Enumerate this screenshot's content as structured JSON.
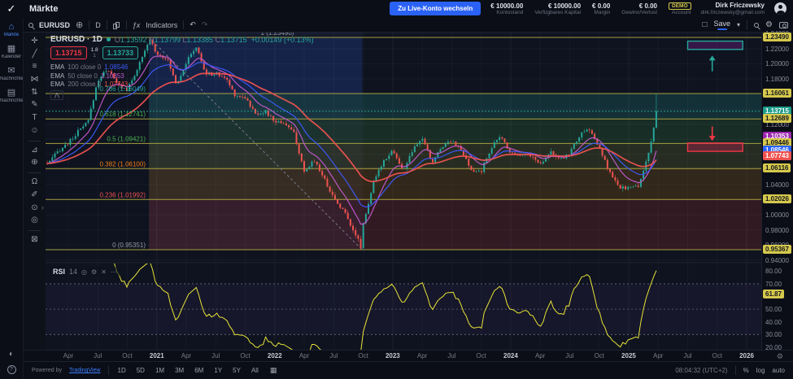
{
  "header": {
    "app_title": "Märkte",
    "live_button_label": "Zu Live-Konto wechseln",
    "stats": [
      {
        "value": "€ 10000.00",
        "label": "Kontostand"
      },
      {
        "value": "€ 10000.00",
        "label": "Verfügbares Kapital"
      },
      {
        "value": "€ 0.00",
        "label": "Margin"
      },
      {
        "value": "€ 0.00",
        "label": "Gewinn/Verlust"
      },
      {
        "value": "DEMO",
        "label": "Account",
        "badge": true
      }
    ],
    "user": {
      "name": "Dirk Friczewsky",
      "email": "dirk.friczewsky@gmail.com"
    }
  },
  "sidebar": {
    "items": [
      {
        "label": "Märkte",
        "icon": "home-icon",
        "glyph": "⌂",
        "active": true
      },
      {
        "label": "Kalender",
        "icon": "calendar-icon",
        "glyph": "▦",
        "active": false
      },
      {
        "label": "Nachrichten",
        "icon": "mail-icon",
        "glyph": "✉",
        "active": false
      },
      {
        "label": "Nachrichten",
        "icon": "news-icon",
        "glyph": "▤",
        "active": false
      }
    ],
    "bottom": [
      {
        "label": "theme-toggle",
        "glyph": "◐"
      },
      {
        "label": "help",
        "glyph": "?"
      }
    ]
  },
  "chart_toolbar": {
    "symbol": "EURUSD",
    "interval": "D",
    "indicators_fx": "ƒx",
    "indicators_label": "Indicators",
    "undo": "↶",
    "redo": "↷",
    "compare": "⊕",
    "layout_square": "□",
    "save_label": "Save",
    "caret": "▾"
  },
  "legend": {
    "symbol_text": "EURUSD · 1D",
    "ohlc": [
      {
        "k": "O",
        "v": "1.13592"
      },
      {
        "k": "H",
        "v": "1.13799"
      },
      {
        "k": "L",
        "v": "1.13385"
      },
      {
        "k": "C",
        "v": "1.13715"
      }
    ],
    "change": "+0.00149 (+0.13%)",
    "bid": "1.13715",
    "ask": "1.13733",
    "spread_top": "1.8",
    "spread_bottom": "1",
    "emas": [
      {
        "label": "EMA 100 close 0",
        "value": "1.08546",
        "color": "#3d5afe"
      },
      {
        "label": "EMA 50 close 0",
        "value": "1.10353",
        "color": "#c45ad0"
      },
      {
        "label": "EMA 200 close 0",
        "value": "1.07743",
        "color": "#ef5350"
      }
    ]
  },
  "price_axis": {
    "ticks": [
      [
        "1.24000",
        1.24
      ],
      [
        "1.22000",
        1.22
      ],
      [
        "1.20000",
        1.2
      ],
      [
        "1.18000",
        1.18
      ],
      [
        "1.16000",
        1.16
      ],
      [
        "1.12000",
        1.12
      ],
      [
        "1.04000",
        1.04
      ],
      [
        "1.00000",
        1.0
      ],
      [
        "0.98000",
        0.98
      ],
      [
        "0.96000",
        0.96
      ],
      [
        "0.94000",
        0.94
      ]
    ],
    "labels": [
      {
        "text": "1.23490",
        "price": 1.2349,
        "bg": "#d5c84c",
        "fg": "#14161f",
        "name": "fib-level-label"
      },
      {
        "text": "1.16061",
        "price": 1.16061,
        "bg": "#d5c84c",
        "fg": "#14161f",
        "name": "level-line-label"
      },
      {
        "text": "1.13715",
        "price": 1.13715,
        "bg": "#1f9d8b",
        "fg": "#ffffff",
        "name": "last-price-label"
      },
      {
        "text": "1.12689",
        "price": 1.12689,
        "bg": "#d5c84c",
        "fg": "#14161f",
        "name": "level-line-label"
      },
      {
        "text": "1.10353",
        "price": 1.10353,
        "bg": "#9c27b0",
        "fg": "#ffffff",
        "name": "ema50-price-label"
      },
      {
        "text": "1.09446",
        "price": 1.09446,
        "bg": "#d5c84c",
        "fg": "#14161f",
        "name": "level-line-label"
      },
      {
        "text": "1.08546",
        "price": 1.08546,
        "bg": "#2962ff",
        "fg": "#ffffff",
        "name": "ema100-price-label"
      },
      {
        "text": "1.07743",
        "price": 1.07743,
        "bg": "#ef5350",
        "fg": "#ffffff",
        "name": "ema200-price-label"
      },
      {
        "text": "1.06116",
        "price": 1.06116,
        "bg": "#d5c84c",
        "fg": "#14161f",
        "name": "level-line-label"
      },
      {
        "text": "1.02026",
        "price": 1.02026,
        "bg": "#d5c84c",
        "fg": "#14161f",
        "name": "level-line-label"
      },
      {
        "text": "0.95367",
        "price": 0.95367,
        "bg": "#d5c84c",
        "fg": "#14161f",
        "name": "level-line-label"
      }
    ]
  },
  "time_axis": {
    "labels": [
      [
        "Apr",
        0,
        0
      ],
      [
        "Jul",
        3,
        0
      ],
      [
        "Oct",
        6,
        0
      ],
      [
        "2021",
        9,
        1
      ],
      [
        "Apr",
        12,
        0
      ],
      [
        "Jul",
        15,
        0
      ],
      [
        "Oct",
        18,
        0
      ],
      [
        "2022",
        21,
        1
      ],
      [
        "Apr",
        24,
        0
      ],
      [
        "Jul",
        27,
        0
      ],
      [
        "Oct",
        30,
        0
      ],
      [
        "2023",
        33,
        1
      ],
      [
        "Apr",
        36,
        0
      ],
      [
        "Jul",
        39,
        0
      ],
      [
        "Oct",
        42,
        0
      ],
      [
        "2024",
        45,
        1
      ],
      [
        "Apr",
        48,
        0
      ],
      [
        "Jul",
        51,
        0
      ],
      [
        "Oct",
        54,
        0
      ],
      [
        "2025",
        57,
        1
      ],
      [
        "Apr",
        60,
        0
      ],
      [
        "Jul",
        63,
        0
      ],
      [
        "Oct",
        66,
        0
      ],
      [
        "2026",
        69,
        1
      ]
    ]
  },
  "rsi_pane": {
    "title": "RSI",
    "param": "14",
    "value": "61.87",
    "value_num": 61.87,
    "ticks": [
      [
        "80.00",
        80
      ],
      [
        "70.00",
        70
      ],
      [
        "50.00",
        50
      ],
      [
        "40.00",
        40
      ],
      [
        "30.00",
        30
      ],
      [
        "20.00",
        20
      ]
    ],
    "line_color": "#e8e337",
    "label_bg": "#d5c84c"
  },
  "bottom_bar": {
    "powered_by": "Powered by",
    "brand": "TradingView",
    "ranges": [
      "1D",
      "5D",
      "1M",
      "3M",
      "6M",
      "1Y",
      "5Y",
      "All"
    ],
    "calendar_glyph": "▦",
    "clock": "08:04:32 (UTC+2)",
    "percent": "%",
    "log": "log",
    "auto": "auto"
  },
  "drawing_tools": [
    {
      "name": "crosshair-tool-icon",
      "glyph": "✛"
    },
    {
      "name": "trendline-tool-icon",
      "glyph": "╱"
    },
    {
      "name": "fib-retracement-tool-icon",
      "glyph": "≡"
    },
    {
      "name": "pattern-tool-icon",
      "glyph": "⋈"
    },
    {
      "name": "long-short-position-tool-icon",
      "glyph": "⇅"
    },
    {
      "name": "brush-tool-icon",
      "glyph": "✎"
    },
    {
      "name": "text-tool-icon",
      "glyph": "T"
    },
    {
      "name": "emoji-tool-icon",
      "glyph": "☺"
    },
    {
      "name": "measure-tool-icon",
      "glyph": "⊿"
    },
    {
      "name": "zoom-in-tool-icon",
      "glyph": "⊕"
    },
    {
      "name": "magnet-tool-icon",
      "glyph": "Ω"
    },
    {
      "name": "drawing-mode-tool-icon",
      "glyph": "✐"
    },
    {
      "name": "lock-drawings-tool-icon",
      "glyph": "⊙"
    },
    {
      "name": "hide-drawings-tool-icon",
      "glyph": "◎"
    },
    {
      "name": "delete-drawings-tool-icon",
      "glyph": "⊠"
    }
  ],
  "separators_after": [
    7,
    9,
    13
  ],
  "chart_data": {
    "type": "candlestick",
    "symbol": "EURUSD",
    "interval": "1D",
    "ohlc_current": {
      "open": 1.13592,
      "high": 1.13799,
      "low": 1.13385,
      "close": 1.13715,
      "change": "+0.00149 (+0.13%)"
    },
    "price_range": [
      0.9375,
      1.2414
    ],
    "x_range_months": [
      "2020-02",
      "2026-01"
    ],
    "monthly_months": [
      "2020-02",
      "2020-03",
      "2020-04",
      "2020-05",
      "2020-06",
      "2020-07",
      "2020-08",
      "2020-09",
      "2020-10",
      "2020-11",
      "2020-12",
      "2021-01",
      "2021-02",
      "2021-03",
      "2021-04",
      "2021-05",
      "2021-06",
      "2021-07",
      "2021-08",
      "2021-09",
      "2021-10",
      "2021-11",
      "2021-12",
      "2022-01",
      "2022-02",
      "2022-03",
      "2022-04",
      "2022-05",
      "2022-06",
      "2022-07",
      "2022-08",
      "2022-09",
      "2022-10",
      "2022-11",
      "2022-12",
      "2023-01",
      "2023-02",
      "2023-03",
      "2023-04",
      "2023-05",
      "2023-06",
      "2023-07",
      "2023-08",
      "2023-09",
      "2023-10",
      "2023-11",
      "2023-12",
      "2024-01",
      "2024-02",
      "2024-03",
      "2024-04",
      "2024-05",
      "2024-06",
      "2024-07",
      "2024-08",
      "2024-09",
      "2024-10",
      "2024-11",
      "2024-12",
      "2025-01",
      "2025-02",
      "2025-03",
      "2025-04"
    ],
    "monthly_closes": [
      1.068,
      1.085,
      1.095,
      1.11,
      1.123,
      1.178,
      1.194,
      1.172,
      1.165,
      1.193,
      1.2216,
      1.2135,
      1.2075,
      1.173,
      1.202,
      1.2227,
      1.1858,
      1.1871,
      1.1809,
      1.158,
      1.1558,
      1.1336,
      1.137,
      1.1235,
      1.1219,
      1.1067,
      1.0545,
      1.0735,
      1.0484,
      1.022,
      1.0054,
      0.9802,
      0.9881,
      1.0405,
      1.0705,
      1.0863,
      1.0577,
      1.0839,
      1.1019,
      1.0687,
      1.0909,
      1.0999,
      1.0843,
      1.0573,
      1.0575,
      1.0888,
      1.1039,
      1.0818,
      1.0805,
      1.079,
      1.0666,
      1.0848,
      1.0713,
      1.0826,
      1.1048,
      1.1135,
      1.0884,
      1.0577,
      1.0354,
      1.0362,
      1.0375,
      1.0816,
      1.13715
    ],
    "extremes": [
      [
        8.2,
        1.2349
      ],
      [
        29.9,
        0.95351
      ],
      [
        59.5,
        1.105
      ],
      [
        59.8,
        1.1573
      ]
    ],
    "candle_up_color": "#26a69a",
    "candle_down_color": "#ef5350",
    "emas": [
      {
        "period": 50,
        "current": 1.10353,
        "color": "#c45ad0",
        "bar_period": 10,
        "width": 1.2
      },
      {
        "period": 100,
        "current": 1.08546,
        "color": "#3d5afe",
        "bar_period": 20,
        "width": 1.2
      },
      {
        "period": 200,
        "current": 1.07743,
        "color": "#ef5350",
        "bar_period": 40,
        "width": 1.7
      }
    ],
    "last_price_line": {
      "price": 1.13715,
      "color": "#2a9d8f"
    },
    "horizontal_lines": {
      "prices": [
        1.2349,
        1.16061,
        1.12689,
        1.09446,
        1.06116,
        1.02026,
        0.95367
      ],
      "color": "#a79f3f"
    },
    "fib": {
      "anchor_high": {
        "m": 8.2,
        "price": 1.2349
      },
      "anchor_low": {
        "m": 29.9,
        "price": 0.95351
      },
      "levels": [
        {
          "text": "1 (1.23490)",
          "price": 1.2349,
          "color": "#9598a1"
        },
        {
          "text": "0.786 (1.16049)",
          "price": 1.16049,
          "color": "#26a69a"
        },
        {
          "text": "0.618 (1.12741)",
          "price": 1.12741,
          "color": "#4caf50"
        },
        {
          "text": "0.5 (1.09421)",
          "price": 1.09421,
          "color": "#4caf50"
        },
        {
          "text": "0.382 (1.06100)",
          "price": 1.061,
          "color": "#f57f17"
        },
        {
          "text": "0.236 (1.01992)",
          "price": 1.01992,
          "color": "#ef5350"
        },
        {
          "text": "0 (0.95351)",
          "price": 0.95351,
          "color": "#9598a1"
        }
      ],
      "bands": [
        {
          "from": 1.2349,
          "to": 1.16049,
          "fill": "rgba(41,98,255,0.14)",
          "column_only": true
        },
        {
          "from": 1.16049,
          "to": 1.12741,
          "fill": "rgba(38,166,154,0.20)"
        },
        {
          "from": 1.12741,
          "to": 1.09421,
          "fill": "rgba(76,175,80,0.17)"
        },
        {
          "from": 1.09421,
          "to": 1.061,
          "fill": "rgba(205,220,57,0.13)"
        },
        {
          "from": 1.061,
          "to": 1.01992,
          "fill": "rgba(255,152,0,0.15)"
        },
        {
          "from": 1.01992,
          "to": 0.95351,
          "fill": "rgba(244,67,54,0.16)"
        }
      ]
    },
    "annotations": {
      "long_zone": {
        "m_from": 63.0,
        "m_to": 68.6,
        "price_from": 1.219,
        "price_to": 1.23,
        "border": "#26a69a",
        "fill": "rgba(156,39,176,0.28)"
      },
      "short_zone": {
        "m_from": 63.0,
        "m_to": 68.6,
        "price_from": 1.084,
        "price_to": 1.095,
        "border": "#f23645",
        "fill": "rgba(233,30,99,0.28)"
      },
      "up_arrow": {
        "m": 65.5,
        "price_tail": 1.19,
        "price_head": 1.211,
        "color": "#26a69a"
      },
      "down_arrow": {
        "m": 65.5,
        "price_tail": 1.117,
        "price_head": 1.098,
        "color": "#f23645"
      }
    },
    "rsi": {
      "period": 14,
      "current": 61.87,
      "overbought": 70,
      "middle": 50,
      "oversold": 30
    }
  }
}
